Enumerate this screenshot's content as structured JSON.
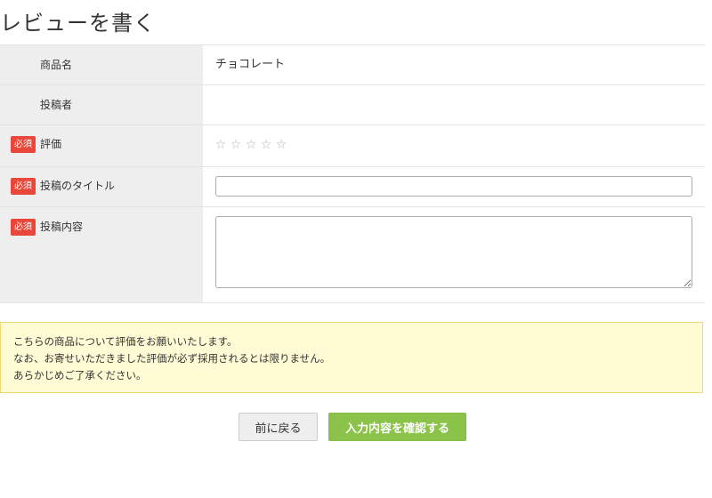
{
  "page": {
    "title": "レビューを書く"
  },
  "form": {
    "required_label": "必須",
    "product_name": {
      "label": "商品名",
      "value": "チョコレート"
    },
    "author": {
      "label": "投稿者",
      "value": ""
    },
    "rating": {
      "label": "評価",
      "stars": [
        "☆",
        "☆",
        "☆",
        "☆",
        "☆"
      ],
      "value": 0,
      "max": 5
    },
    "review_title": {
      "label": "投稿のタイトル",
      "value": "",
      "placeholder": ""
    },
    "review_body": {
      "label": "投稿内容",
      "value": "",
      "placeholder": ""
    }
  },
  "notice": {
    "lines": [
      "こちらの商品について評価をお願いいたします。",
      "なお、お寄せいただきました評価が必ず採用されるとは限りません。",
      "あらかじめご了承ください。"
    ]
  },
  "actions": {
    "back_label": "前に戻る",
    "confirm_label": "入力内容を確認する"
  },
  "colors": {
    "required_badge": "#e8473a",
    "confirm_button": "#8bc34a",
    "notice_background": "#fffbd5",
    "notice_border": "#f2d774",
    "label_background": "#eeeeee",
    "star": "#b5b5b5"
  }
}
